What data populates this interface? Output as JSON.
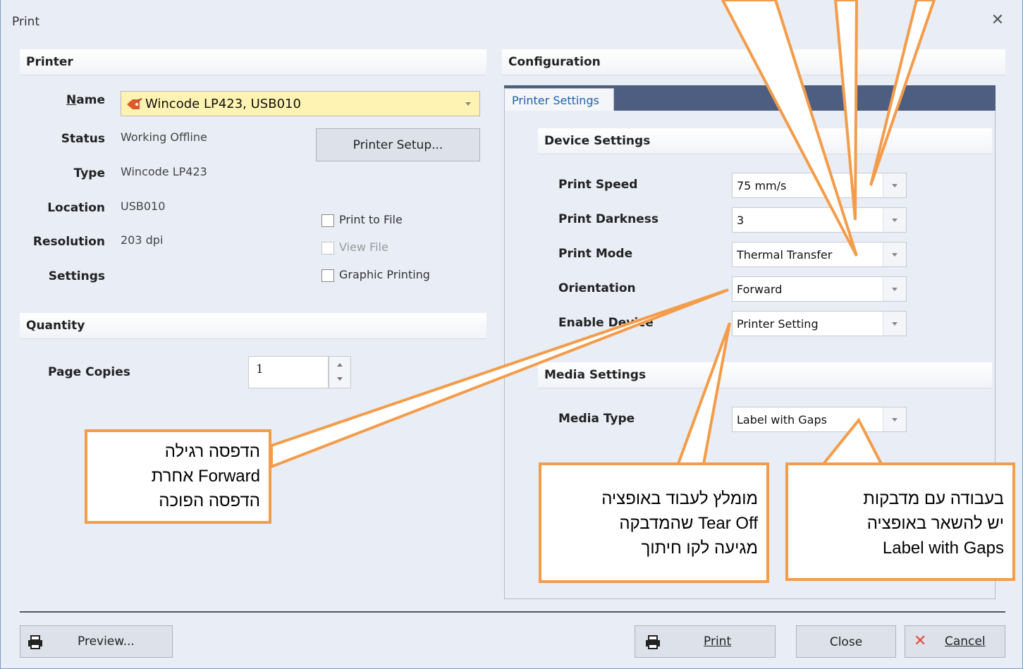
{
  "window": {
    "title": "Print",
    "close_glyph": "✕"
  },
  "printer": {
    "section_title": "Printer",
    "name_label": "Name",
    "name_value": "Wincode LP423,  USB010",
    "status_label": "Status",
    "status_value": "Working Offline",
    "type_label": "Type",
    "type_value": "Wincode LP423",
    "location_label": "Location",
    "location_value": "USB010",
    "resolution_label": "Resolution",
    "resolution_value": "203 dpi",
    "settings_label": "Settings",
    "setup_button": "Printer Setup...",
    "print_to_file": "Print to File",
    "view_file": "View File",
    "graphic_printing": "Graphic Printing"
  },
  "quantity": {
    "section_title": "Quantity",
    "copies_label": "Page Copies",
    "copies_value": "1"
  },
  "configuration": {
    "section_title": "Configuration",
    "tab_label": "Printer Settings",
    "device_title": "Device Settings",
    "print_speed_label": "Print Speed",
    "print_speed_value": "75  mm/s",
    "print_darkness_label": "Print Darkness",
    "print_darkness_value": "3",
    "print_mode_label": "Print Mode",
    "print_mode_value": "Thermal Transfer",
    "orientation_label": "Orientation",
    "orientation_value": "Forward",
    "enable_device_label": "Enable Device",
    "enable_device_value": "Printer Setting",
    "media_title": "Media Settings",
    "media_type_label": "Media Type",
    "media_type_value": "Label with Gaps"
  },
  "callouts": {
    "left": [
      "הדפסה רגילה",
      "Forward אחרת",
      "הדפסה הפוכה"
    ],
    "middle": [
      "מומלץ לעבוד באופציה",
      "Tear Off שהמדבקה",
      "מגיעה לקו חיתוך"
    ],
    "right": [
      "בעבודה עם מדבקות",
      "יש להשאר באופציה",
      "Label with Gaps"
    ]
  },
  "footer": {
    "preview_button": "Preview...",
    "print_button": "Print",
    "close_button": "Close",
    "cancel_button": "Cancel"
  },
  "colors": {
    "accent_orange": "#f39c4a",
    "tab_strip": "#4d5e80",
    "name_highlight": "#fff3b3"
  },
  "icons": [
    "printer-icon",
    "tag-icon",
    "cancel-x-icon",
    "close-icon",
    "spin-up-icon",
    "spin-down-icon",
    "chevron-down-icon"
  ]
}
